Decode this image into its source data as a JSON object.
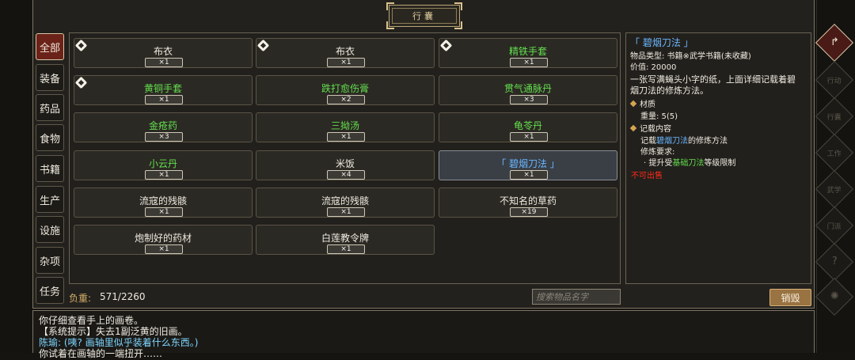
{
  "panel": {
    "title": "行囊"
  },
  "categories": [
    {
      "label": "全部",
      "active": true
    },
    {
      "label": "装备"
    },
    {
      "label": "药品"
    },
    {
      "label": "食物"
    },
    {
      "label": "书籍"
    },
    {
      "label": "生产"
    },
    {
      "label": "设施"
    },
    {
      "label": "杂项"
    },
    {
      "label": "任务"
    }
  ],
  "items": [
    {
      "name": "布衣",
      "qty": "×1",
      "color": "white",
      "badge": true
    },
    {
      "name": "布衣",
      "qty": "×1",
      "color": "white",
      "badge": true
    },
    {
      "name": "精铁手套",
      "qty": "×1",
      "color": "green",
      "badge": true
    },
    {
      "name": "黄铜手套",
      "qty": "×1",
      "color": "green",
      "badge": true
    },
    {
      "name": "跌打愈伤膏",
      "qty": "×2",
      "color": "green"
    },
    {
      "name": "贯气通脉丹",
      "qty": "×3",
      "color": "green"
    },
    {
      "name": "金疮药",
      "qty": "×3",
      "color": "green"
    },
    {
      "name": "三拗汤",
      "qty": "×1",
      "color": "green"
    },
    {
      "name": "龟苓丹",
      "qty": "×1",
      "color": "green"
    },
    {
      "name": "小云丹",
      "qty": "×1",
      "color": "green"
    },
    {
      "name": "米饭",
      "qty": "×4",
      "color": "white"
    },
    {
      "name": "「 碧烟刀法 」",
      "qty": "×1",
      "color": "blue",
      "selected": true
    },
    {
      "name": "流寇的残骸",
      "qty": "×1",
      "color": "white"
    },
    {
      "name": "流寇的残骸",
      "qty": "×1",
      "color": "white"
    },
    {
      "name": "不知名的草药",
      "qty": "×19",
      "color": "white"
    },
    {
      "name": "炮制好的药材",
      "qty": "×1",
      "color": "white"
    },
    {
      "name": "白莲教令牌",
      "qty": "×1",
      "color": "white"
    }
  ],
  "footer": {
    "weight_label": "负重:",
    "weight_value": "571/2260",
    "search_placeholder": "搜索物品名字",
    "destroy_label": "销毁"
  },
  "detail": {
    "title": "「 碧烟刀法 」",
    "type": "物品类型: 书籍※武学书籍(未收藏)",
    "value": "价值: 20000",
    "desc_1": "一张写满蝇头小字的纸，上面详细记载着碧",
    "desc_2": "烟刀法的修炼方法。",
    "material_header": "材质",
    "weight": "重量: 5(5)",
    "content_header": "记载内容",
    "record_prefix": "记载",
    "record_skill": "碧烟刀法",
    "record_suffix": "的修炼方法",
    "requirement_label": "修炼要求:",
    "req_prefix": "· 提升受",
    "req_skill": "基础刀法",
    "req_suffix": "等级限制",
    "not_for_sale": "不可出售"
  },
  "right_rail": [
    {
      "label": "",
      "icon": "back-arrow-icon",
      "active": true
    },
    {
      "label": "行动"
    },
    {
      "label": "行囊"
    },
    {
      "label": "工作"
    },
    {
      "label": "武学"
    },
    {
      "label": "门派"
    },
    {
      "label": "?"
    },
    {
      "label": "",
      "icon": "settings-icon"
    }
  ],
  "log": [
    "你仔细查看手上的画卷。",
    "【系统提示】失去1副泛黄的旧画。",
    "陈瑜: (咦? 画轴里似乎装着什么东西。)",
    "你试着在画轴的一端扭开……"
  ]
}
